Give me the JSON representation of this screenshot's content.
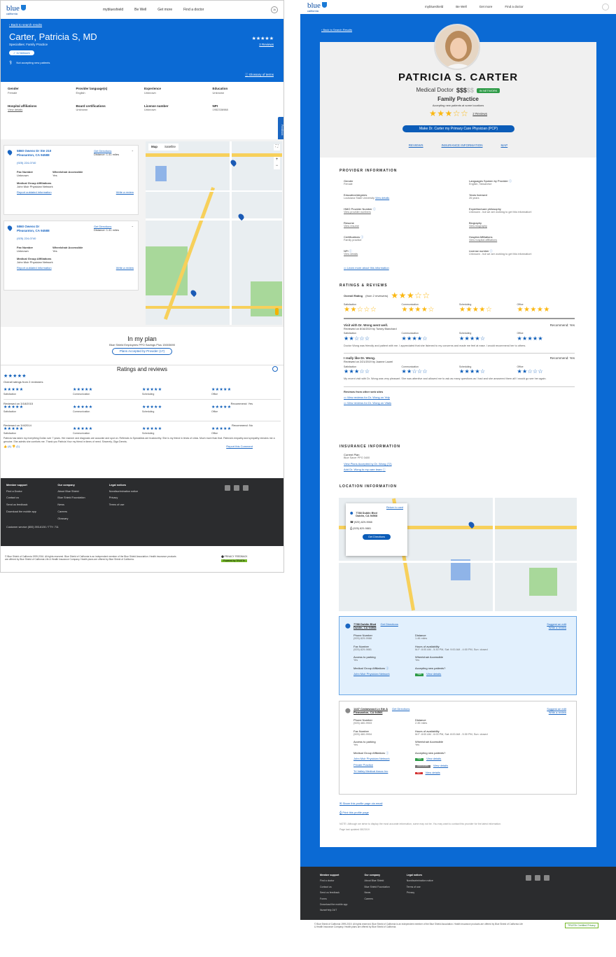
{
  "left": {
    "nav": [
      "myblueshield",
      "Be Well",
      "Get more",
      "Find a doctor"
    ],
    "user_badge": "Ju",
    "logo": {
      "blue": "blue",
      "sub": "california"
    },
    "back": "Back to search results",
    "name": "Carter, Patricia S, MD",
    "specialties": "Specialties: Family Practice",
    "reviews_link": "2 Reviews",
    "in_network": "In Network",
    "accepting": "Not accepting new patients",
    "glossary": "Glossary of terms",
    "info": [
      {
        "k": "Gender",
        "v": "Female"
      },
      {
        "k": "Provider language(s)",
        "v": "English"
      },
      {
        "k": "Experience",
        "v": "Unknown"
      },
      {
        "k": "Education",
        "v": "Unknown"
      },
      {
        "k": "Hospital affiliations",
        "v": "View details"
      },
      {
        "k": "Board certifications",
        "v": "Unknown"
      },
      {
        "k": "License number",
        "v": "Unknown"
      },
      {
        "k": "NPI",
        "v": "1952336988"
      }
    ],
    "feedback": "Feedback",
    "locations": [
      {
        "addr1": "5860 Owens Dr Ste 210",
        "addr2": "Pleasanton, CA 94588",
        "dir": "Get Directions",
        "dist": "Distance: 1.41 miles",
        "phone": "(925) 224-0740",
        "fax": "Fax Number",
        "fax_v": "Unknown",
        "wc": "Wheelchair Accessible",
        "wc_v": "Yes",
        "mga": "Medical Group Affiliations",
        "mga_v": "John Muir Physician Network",
        "report": "Report outdated information",
        "write": "Write a review"
      },
      {
        "addr1": "5860 Owens Dr",
        "addr2": "Pleasanton, CA 94588",
        "dir": "Get Directions",
        "dist": "Distance: 1.41 miles",
        "phone": "(925) 224-0740",
        "fax": "Fax Number",
        "fax_v": "Unknown",
        "wc": "Wheelchair Accessible",
        "wc_v": "Yes",
        "mga": "Medical Group Affiliations",
        "mga_v": "John Muir Physician Network",
        "report": "Report outdated information",
        "write": "Write a review"
      }
    ],
    "map_tabs": [
      "Map",
      "Satellite"
    ],
    "plan_title": "In my plan",
    "plan_sub": "Blue Shield Employees PPO Savings Plus 15003690",
    "plan_btn": "Plans Accepted by Provider (17)",
    "ratings_title": "Ratings and reviews",
    "overall": "Overall ratings from 2 reviewers",
    "cats": [
      "Satisfaction",
      "Communication",
      "Scheduling",
      "Office"
    ],
    "rev1_date": "Reviewed on 3/18/2015",
    "rev1_rec": "Recommend: Yes",
    "rev2_date": "Reviewed on 3/4/2014",
    "rev2_rec": "Recommend: No",
    "rev_text": "Patricia has taken my everything Dollar over 7 years. Her manner and diagnosis are accurate and spot on. Referrals to Specialists are trustworthy. She is my friend in times of crisis. Much more than that. Patricia's empathy and sympathy remains me a genuine. She admits she comforts me. Thank you Patricia Your my friend in times of need. Sincerely, Olga Dennis.",
    "rev_counts": [
      "(4)",
      "(1)"
    ],
    "report_comment": "Report this Comment",
    "footer": {
      "cols": [
        {
          "h": "Member support",
          "items": [
            "Find a Doctor",
            "Contact us",
            "Send us feedback",
            "Download the mobile app"
          ]
        },
        {
          "h": "Our company",
          "items": [
            "About Blue Shield",
            "Blue Shield Foundation",
            "News",
            "Careers",
            "Glossary"
          ]
        },
        {
          "h": "Legal notices",
          "items": [
            "Nondiscrimination notice",
            "Privacy",
            "Terms of use"
          ]
        }
      ],
      "service": "Customer service   (800) 393-6130   /   TTY: 711",
      "legal": "© Blue Shield of California 1999-2016. All rights reserved. Blue Shield of California is an independent member of the Blue Shield Association. Health insurance products are offered by Blue Shield of California Life & Health Insurance Company. Health plans are offered by Blue Shield of California.",
      "privacy": "PRIVACY FEEDBACK",
      "truste": "Powered by TRUSTe"
    }
  },
  "right": {
    "nav": [
      "myblueshield",
      "Be Well",
      "Get more",
      "Find a doctor"
    ],
    "back": "Back to Search Results",
    "name": "PATRICIA S. CARTER",
    "title": "Medical Doctor",
    "cost": "$$$",
    "cost_dim": "$$",
    "network": "IN NETWORK",
    "specialty": "Family Practice",
    "accepting": "Accepting new patients at some locations",
    "reviews": "2 Reviews",
    "pcp_btn": "Make Dr. Carter my Primary Care Physician (PCP)",
    "tabs": [
      "REVIEWS",
      "INSURANCE INFORMATION",
      "MAP"
    ],
    "prov_title": "PROVIDER INFORMATION",
    "prov_left": [
      {
        "k": "Gender",
        "v": "Female"
      },
      {
        "k": "Education/degrees",
        "v": "Louisiana State University",
        "link": "View details"
      },
      {
        "k": "HMO Provider Number",
        "v": "",
        "link": "View provider numbers"
      },
      {
        "k": "Resume",
        "v": "",
        "link": "View resume"
      },
      {
        "k": "Certifications",
        "v": "Family practice"
      },
      {
        "k": "NPI",
        "v": "",
        "link": "View details"
      }
    ],
    "prov_right": [
      {
        "k": "Languages Spoken by Provider",
        "v": "English, Taiwanese"
      },
      {
        "k": "Years licensed",
        "v": "26 years"
      },
      {
        "k": "Expertise/care philosophy",
        "v": "Unknown - but we are working to get this information!"
      },
      {
        "k": "Biography",
        "v": "",
        "link": "View biography"
      },
      {
        "k": "Hospital Affiliations",
        "v": "",
        "link": "View hospital affiliations"
      },
      {
        "k": "License number",
        "v": "Unknown - but we are working to get this information!"
      }
    ],
    "learn_more": "Learn more about this information",
    "ratings_title": "RATINGS & REVIEWS",
    "overall": "Overall Rating",
    "overall_sub": "(from 2 reviewers)",
    "cats": [
      "Satisfaction",
      "Communication",
      "Scheduling",
      "Office"
    ],
    "rev1": {
      "title": "Visit with Dr. Wong went well.",
      "by": "Reviewed on 8/16/2019 by Turkey Blanchard",
      "rec": "Recommend: Yes",
      "text": "Doctor Wong was friendly and patient with me. I appreciated that she listened to my concerns and made me feel at ease. I would recommend her to others."
    },
    "rev2": {
      "title": "I really like Dr. Wong.",
      "by": "Reviewed on 2/21/2019 by Joanne Laurel",
      "rec": "Recommend: Yes",
      "text": "My recent visit with Dr. Wong was very pleasant. She was attentive and allowed me to ask as many questions as I had and she answered them all! I would go see her again."
    },
    "other_sites": "Reviews from other web sites",
    "other_links": [
      "View reviews for Dr. Wong on Yelp",
      "View reviews for Dr. Wong on Vitals"
    ],
    "ins_title": "INSURANCE INFORMATION",
    "current_plan": "Current Plan",
    "current_plan_v": "Blue Saver PPO 3400",
    "ins_links": [
      "View Plans Accepted by Dr. Wong (72)",
      "Add Dr. Wong to my care team"
    ],
    "loc_title": "LOCATION INFORMATION",
    "map_card": {
      "return": "Return to card",
      "addr1": "7788 Dublin Blvd",
      "addr2": "Dublin, CA 94568",
      "phone": "(925) 829-9988",
      "fax": "(925) 829-9881",
      "btn": "Get Directions"
    },
    "locs": [
      {
        "addr1": "7788 Dublin Blvd",
        "addr2": "Dublin, CA 94568",
        "dir": "Get Directions",
        "suggest": "Suggest an edit",
        "write": "Write a review",
        "phone_k": "Phone Number",
        "phone": "(925) 829-9988",
        "dist_k": "Distance",
        "dist": "1.46 miles",
        "fax_k": "Fax Number",
        "fax": "(925) 829-9881",
        "hours_k": "Hours of availability",
        "hours": "M-F: 8:00 AM - 5:30 PM, Sat: 9:00 AM - 4:00 PM, Sun: closed",
        "park_k": "Access to parking",
        "park": "Yes",
        "wc_k": "Wheelchair Accessible",
        "wc": "Yes",
        "mga_k": "Medical Group Affiliations",
        "acc_k": "Accepting new patients?",
        "groups": [
          {
            "name": "John Muir Physician Network",
            "tag": "YES",
            "link": "View details"
          }
        ]
      },
      {
        "addr1": "1447 Cedarwood Ln Ste A",
        "addr2": "Pleasanton, CA 94566",
        "dir": "Get Directions",
        "suggest": "Suggest an edit",
        "write": "Write a review",
        "phone_k": "Phone Number",
        "phone": "(925) 460-9903",
        "dist_k": "Distance",
        "dist": "2.35 miles",
        "fax_k": "Fax Number",
        "fax": "(925) 460-9904",
        "hours_k": "Hours of availability",
        "hours": "M-F: 8:00 AM - 6:00 PM, Sat: 8:00 AM - 5:30 PM, Sun: closed",
        "park_k": "Access to parking",
        "park": "Yes",
        "wc_k": "Wheelchair Accessible",
        "wc": "Yes",
        "mga_k": "Medical Group Affiliations",
        "acc_k": "Accepting new patients?",
        "groups": [
          {
            "name": "John Muir Physician Network",
            "tag": "YES",
            "link": "View details"
          },
          {
            "name": "Private Practice",
            "tag": "UNKNOWN",
            "link": "View details"
          },
          {
            "name": "Tri Valley Medical Assoc Inc",
            "tag": "NO",
            "link": "View details"
          }
        ]
      }
    ],
    "share": "Share this profile page via email",
    "print": "Print this profile page",
    "note": "NOTE: Although we strive to display the most accurate information, some may not be. You may want to contact this provider for the latest information.",
    "updated": "Page last updated 08/23/19",
    "footer": {
      "cols": [
        {
          "h": "Member support",
          "items": [
            "Find a doctor",
            "Contact us",
            "Send us feedback",
            "Forms",
            "Download the mobile app",
            "NurseHelp 24/7"
          ]
        },
        {
          "h": "Our company",
          "items": [
            "About Blue Shield",
            "Blue Shield Foundation",
            "News",
            "Careers"
          ]
        },
        {
          "h": "Legal notices",
          "items": [
            "Nondiscrimination notice",
            "Terms of use",
            "Privacy"
          ]
        }
      ],
      "legal": "© Blue Shield of California 1999-2019. All rights reserved. Blue Shield of California is an independent member of the Blue Shield Association. Health insurance products are offered by Blue Shield of California Life & Health Insurance Company. Health plans are offered by Blue Shield of California.",
      "truste": "TRUSTe Certified Privacy"
    }
  },
  "colors": {
    "brand": "#0b6ad4",
    "star": "#fbb813",
    "footer": "#2b2c2e",
    "green": "#2e9b47"
  }
}
